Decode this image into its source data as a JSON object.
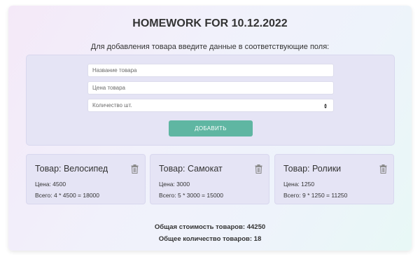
{
  "page": {
    "title": "HOMEWORK FOR 10.12.2022",
    "form_hint": "Для добавления товара введите данные в соответствующие поля:"
  },
  "form": {
    "name_placeholder": "Название товара",
    "price_placeholder": "Цена товара",
    "qty_placeholder": "Количество шт.",
    "add_label": "ДОБАВИТЬ"
  },
  "products": [
    {
      "title": "Товар: Велосипед",
      "price": "Цена: 4500",
      "total": "Всего: 4 * 4500 = 18000",
      "icon": "trash-icon"
    },
    {
      "title": "Товар: Самокат",
      "price": "Цена: 3000",
      "total": "Всего: 5 * 3000 = 15000",
      "icon": "trash-icon"
    },
    {
      "title": "Товар: Ролики",
      "price": "Цена: 1250",
      "total": "Всего: 9 * 1250 = 11250",
      "icon": "trash-icon"
    }
  ],
  "summary": {
    "total_text": "Общая стоимость товаров: 44250",
    "count_text": "Общее количество товаров: 18"
  },
  "colors": {
    "accent_button": "#5fb6a2",
    "panel": "#e5e4f5",
    "icon": "#888888"
  }
}
